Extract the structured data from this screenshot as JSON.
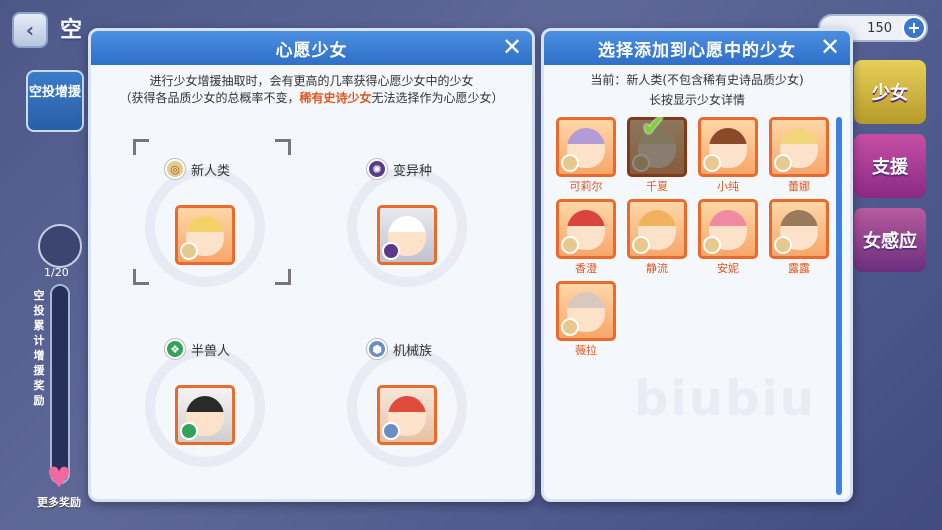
{
  "background": {
    "back_icon": "chevron-left-icon",
    "title_fragment": "空",
    "side_tab": "空投增援",
    "counter": "1/20",
    "side_label": "空投累计增援奖励",
    "more_reward": "更多奖励",
    "currency_value": "150",
    "right_tabs": [
      "少女",
      "支援",
      "女感应"
    ]
  },
  "wish_panel": {
    "title": "心愿少女",
    "close": "✕",
    "desc_line1": "进行少女增援抽取时，会有更高的几率获得心愿少女中的少女",
    "desc_line2_a": "（获得各品质少女的总概率不变，",
    "desc_line2_hl": "稀有史诗少女",
    "desc_line2_b": "无法选择作为心愿少女）",
    "slots": [
      {
        "race": "新人类",
        "icon": "human-race-icon"
      },
      {
        "race": "变异种",
        "icon": "mutant-race-icon"
      },
      {
        "race": "半兽人",
        "icon": "beast-race-icon"
      },
      {
        "race": "机械族",
        "icon": "mech-race-icon"
      }
    ]
  },
  "select_panel": {
    "title": "选择添加到心愿中的少女",
    "close": "✕",
    "current": "当前：新人类(不包含稀有史诗品质少女)",
    "hint": "长按显示少女详情",
    "watermark": "biubiu",
    "girls": [
      {
        "name": "可莉尔",
        "selected": false
      },
      {
        "name": "千夏",
        "selected": true
      },
      {
        "name": "小纯",
        "selected": false
      },
      {
        "name": "蕾娜",
        "selected": false
      },
      {
        "name": "香澄",
        "selected": false
      },
      {
        "name": "静流",
        "selected": false
      },
      {
        "name": "安妮",
        "selected": false
      },
      {
        "name": "露露",
        "selected": false
      },
      {
        "name": "薇拉",
        "selected": false
      }
    ]
  }
}
